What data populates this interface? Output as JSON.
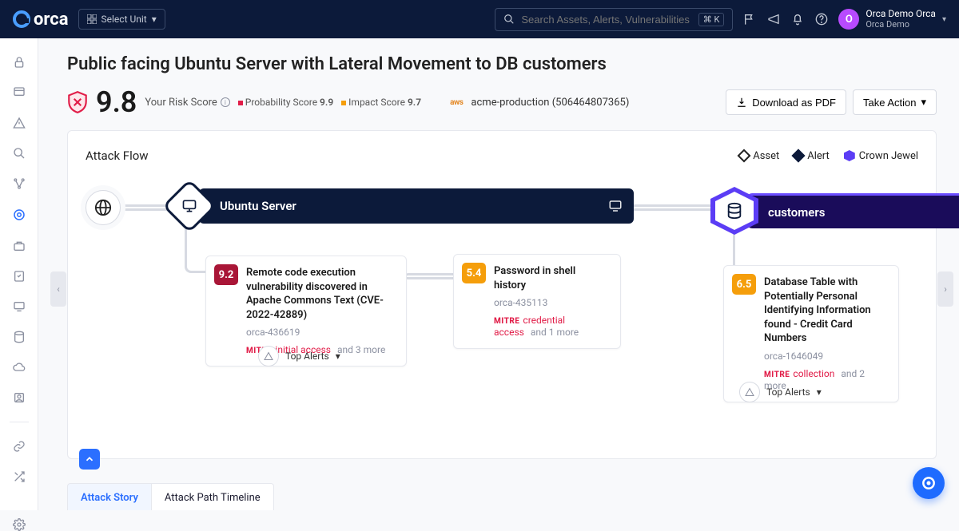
{
  "header": {
    "brand": "orca",
    "select_unit": "Select Unit",
    "search_placeholder": "Search Assets, Alerts, Vulnerabilities",
    "shortcut": "⌘ K",
    "user_name": "Orca Demo Orca",
    "user_sub": "Orca Demo",
    "avatar_initial": "O"
  },
  "page": {
    "title": "Public facing Ubuntu Server with Lateral Movement to DB customers",
    "risk_score": "9.8",
    "risk_label": "Your Risk Score",
    "prob_label": "Probability Score",
    "prob_value": "9.9",
    "impact_label": "Impact Score",
    "impact_value": "9.7",
    "provider": "aws",
    "account": "acme-production (506464807365)",
    "download_btn": "Download as PDF",
    "take_action_btn": "Take Action"
  },
  "flow": {
    "panel_title": "Attack Flow",
    "legend_asset": "Asset",
    "legend_alert": "Alert",
    "legend_crown": "Crown Jewel",
    "asset1": "Ubuntu Server",
    "asset2": "customers",
    "alert1": {
      "score": "9.2",
      "title": "Remote code execution vulnerability discovered in Apache Commons Text (CVE-2022-42889)",
      "id": "orca-436619",
      "tactic": "initial access",
      "more": "and 3 more"
    },
    "alert2": {
      "score": "5.4",
      "title": "Password in shell history",
      "id": "orca-435113",
      "tactic": "credential access",
      "more": "and 1 more"
    },
    "alert3": {
      "score": "6.5",
      "title": "Database Table with Potentially Personal Identifying Information found - Credit Card Numbers",
      "id": "orca-1646049",
      "tactic": "collection",
      "more": "and 2 more"
    },
    "top_alerts": "Top Alerts",
    "mitre": "MITRE"
  },
  "tabs": {
    "story": "Attack Story",
    "timeline": "Attack Path Timeline"
  }
}
